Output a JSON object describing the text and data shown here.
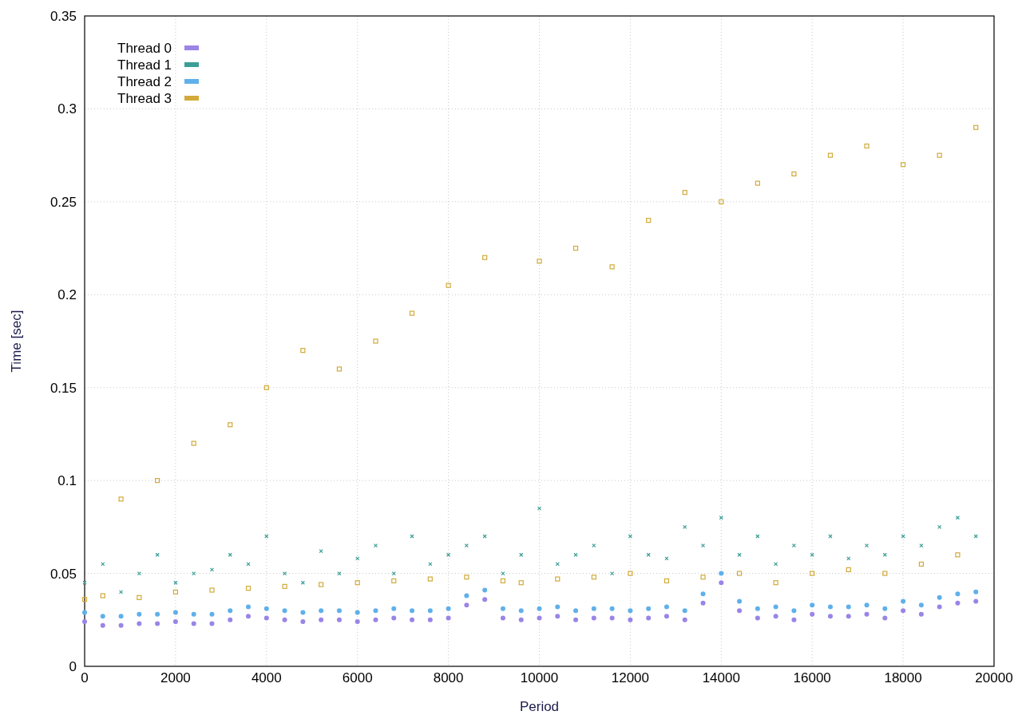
{
  "chart_data": {
    "type": "scatter",
    "grid": true,
    "legend": true,
    "xlabel": "Period",
    "ylabel": "Time [sec]",
    "xlim": [
      0,
      20000
    ],
    "ylim": [
      0,
      0.35
    ],
    "xticks": [
      0,
      2000,
      4000,
      6000,
      8000,
      10000,
      12000,
      14000,
      16000,
      18000,
      20000
    ],
    "yticks": [
      0,
      0.05,
      0.1,
      0.15,
      0.2,
      0.25,
      0.3,
      0.35
    ],
    "x": [
      0,
      400,
      800,
      1200,
      1600,
      2000,
      2400,
      2800,
      3200,
      3600,
      4000,
      4400,
      4800,
      5200,
      5600,
      6000,
      6400,
      6800,
      7200,
      7600,
      8000,
      8400,
      8800,
      9200,
      9600,
      10000,
      10400,
      10800,
      11200,
      11600,
      12000,
      12400,
      12800,
      13200,
      13600,
      14000,
      14400,
      14800,
      15200,
      15600,
      16000,
      16400,
      16800,
      17200,
      17600,
      18000,
      18400,
      18800,
      19200,
      19600
    ],
    "series": [
      {
        "name": "Thread 0",
        "color": "#9a84e6",
        "marker": "circle",
        "values": [
          0.024,
          0.022,
          0.022,
          0.023,
          0.023,
          0.024,
          0.023,
          0.023,
          0.025,
          0.027,
          0.026,
          0.025,
          0.024,
          0.025,
          0.025,
          0.024,
          0.025,
          0.026,
          0.025,
          0.025,
          0.026,
          0.033,
          0.036,
          0.026,
          0.025,
          0.026,
          0.027,
          0.025,
          0.026,
          0.026,
          0.025,
          0.026,
          0.027,
          0.025,
          0.034,
          0.045,
          0.03,
          0.026,
          0.027,
          0.025,
          0.028,
          0.027,
          0.027,
          0.028,
          0.026,
          0.03,
          0.028,
          0.032,
          0.034,
          0.035
        ]
      },
      {
        "name": "Thread 1",
        "color": "#3a9e96",
        "marker": "cross",
        "values": [
          0.045,
          0.055,
          0.04,
          0.05,
          0.06,
          0.045,
          0.05,
          0.052,
          0.06,
          0.055,
          0.07,
          0.05,
          0.045,
          0.062,
          0.05,
          0.058,
          0.065,
          0.05,
          0.07,
          0.055,
          0.06,
          0.065,
          0.07,
          0.05,
          0.06,
          0.085,
          0.055,
          0.06,
          0.065,
          0.05,
          0.07,
          0.06,
          0.058,
          0.075,
          0.065,
          0.08,
          0.06,
          0.07,
          0.055,
          0.065,
          0.06,
          0.07,
          0.058,
          0.065,
          0.06,
          0.07,
          0.065,
          0.075,
          0.08,
          0.07
        ]
      },
      {
        "name": "Thread 2",
        "color": "#5fb0ea",
        "marker": "circle",
        "values": [
          0.029,
          0.027,
          0.027,
          0.028,
          0.028,
          0.029,
          0.028,
          0.028,
          0.03,
          0.032,
          0.031,
          0.03,
          0.029,
          0.03,
          0.03,
          0.029,
          0.03,
          0.031,
          0.03,
          0.03,
          0.031,
          0.038,
          0.041,
          0.031,
          0.03,
          0.031,
          0.032,
          0.03,
          0.031,
          0.031,
          0.03,
          0.031,
          0.032,
          0.03,
          0.039,
          0.05,
          0.035,
          0.031,
          0.032,
          0.03,
          0.033,
          0.032,
          0.032,
          0.033,
          0.031,
          0.035,
          0.033,
          0.037,
          0.039,
          0.04
        ]
      },
      {
        "name": "Thread 3",
        "color": "#d1aa3a",
        "marker": "square",
        "values": [
          0.036,
          0.038,
          0.09,
          0.037,
          0.1,
          0.04,
          0.12,
          0.041,
          0.13,
          0.042,
          0.15,
          0.043,
          0.17,
          0.044,
          0.16,
          0.045,
          0.175,
          0.046,
          0.19,
          0.047,
          0.205,
          0.048,
          0.22,
          0.046,
          0.045,
          0.218,
          0.047,
          0.225,
          0.048,
          0.215,
          0.05,
          0.24,
          0.046,
          0.255,
          0.048,
          0.25,
          0.05,
          0.26,
          0.045,
          0.265,
          0.05,
          0.275,
          0.052,
          0.28,
          0.05,
          0.27,
          0.055,
          0.275,
          0.06,
          0.29
        ]
      }
    ]
  }
}
